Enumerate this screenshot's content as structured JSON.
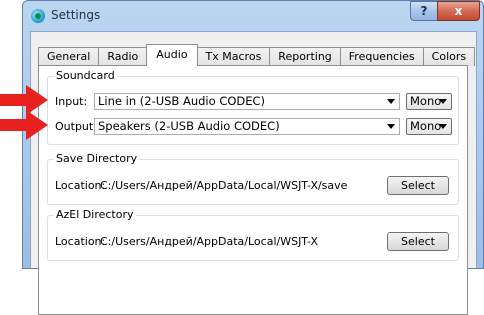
{
  "window": {
    "title": "Settings",
    "help_label": "?",
    "close_label": "x"
  },
  "tabs": [
    "General",
    "Radio",
    "Audio",
    "Tx Macros",
    "Reporting",
    "Frequencies",
    "Colors"
  ],
  "active_tab": "Audio",
  "soundcard": {
    "title": "Soundcard",
    "input_label": "Input:",
    "input_value": "Line in (2-USB Audio CODEC)",
    "input_channel": "Mono",
    "output_label": "Output:",
    "output_value": "Speakers (2-USB Audio CODEC)",
    "output_channel": "Mono"
  },
  "save_directory": {
    "title": "Save Directory",
    "location_label": "Location:",
    "path": "C:/Users/Андрей/AppData/Local/WSJT-X/save",
    "button": "Select"
  },
  "azel_directory": {
    "title": "AzEl Directory",
    "location_label": "Location:",
    "path": "C:/Users/Андрей/AppData/Local/WSJT-X",
    "button": "Select"
  },
  "colors": {
    "annotation_arrow": "#e8201e"
  }
}
